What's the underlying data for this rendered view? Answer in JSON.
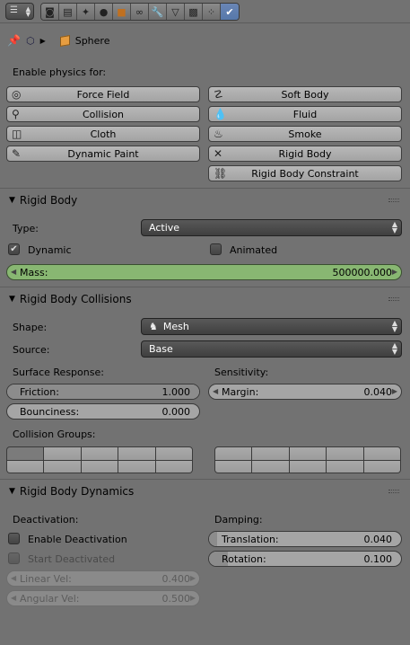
{
  "header": {
    "editor_selector_icon": "properties-editor-icon",
    "context_tabs": [
      {
        "icon": "render-icon"
      },
      {
        "icon": "render-layers-icon"
      },
      {
        "icon": "scene-icon"
      },
      {
        "icon": "world-icon"
      },
      {
        "icon": "object-icon"
      },
      {
        "icon": "constraints-icon"
      },
      {
        "icon": "modifiers-icon"
      },
      {
        "icon": "data-icon"
      },
      {
        "icon": "material-icon"
      },
      {
        "icon": "particles-icon"
      },
      {
        "icon": "physics-icon",
        "active": true
      }
    ]
  },
  "breadcrumb": {
    "object_name": "Sphere"
  },
  "enable_physics": {
    "label": "Enable physics for:",
    "buttons": {
      "force_field": "Force Field",
      "collision": "Collision",
      "cloth": "Cloth",
      "dynamic_paint": "Dynamic Paint",
      "soft_body": "Soft Body",
      "fluid": "Fluid",
      "smoke": "Smoke",
      "rigid_body": "Rigid Body",
      "rigid_body_constraint": "Rigid Body Constraint"
    }
  },
  "rigid_body": {
    "title": "Rigid Body",
    "type_label": "Type:",
    "type_value": "Active",
    "dynamic_label": "Dynamic",
    "dynamic_checked": true,
    "animated_label": "Animated",
    "animated_checked": false,
    "mass_label": "Mass:",
    "mass_value": "500000.000"
  },
  "collisions": {
    "title": "Rigid Body Collisions",
    "shape_label": "Shape:",
    "shape_value": "Mesh",
    "source_label": "Source:",
    "source_value": "Base",
    "surface_response_label": "Surface Response:",
    "friction_label": "Friction:",
    "friction_value": "1.000",
    "friction_fraction": 1.0,
    "bounciness_label": "Bounciness:",
    "bounciness_value": "0.000",
    "bounciness_fraction": 0.0,
    "sensitivity_label": "Sensitivity:",
    "margin_label": "Margin:",
    "margin_value": "0.040",
    "collision_groups_label": "Collision Groups:",
    "groups_active_index": 0
  },
  "dynamics": {
    "title": "Rigid Body Dynamics",
    "deactivation_label": "Deactivation:",
    "enable_deactivation_label": "Enable Deactivation",
    "enable_deactivation_checked": false,
    "start_deactivated_label": "Start Deactivated",
    "start_deactivated_checked": false,
    "linear_vel_label": "Linear Vel:",
    "linear_vel_value": "0.400",
    "angular_vel_label": "Angular Vel:",
    "angular_vel_value": "0.500",
    "damping_label": "Damping:",
    "translation_label": "Translation:",
    "translation_value": "0.040",
    "translation_fraction": 0.04,
    "rotation_label": "Rotation:",
    "rotation_value": "0.100",
    "rotation_fraction": 0.1
  },
  "colors": {
    "background": "#727272",
    "button": "#a8a8a8",
    "selector": "#4a4a4a",
    "mass_field": "#88b772",
    "active_tab": "#5f7fb2"
  }
}
